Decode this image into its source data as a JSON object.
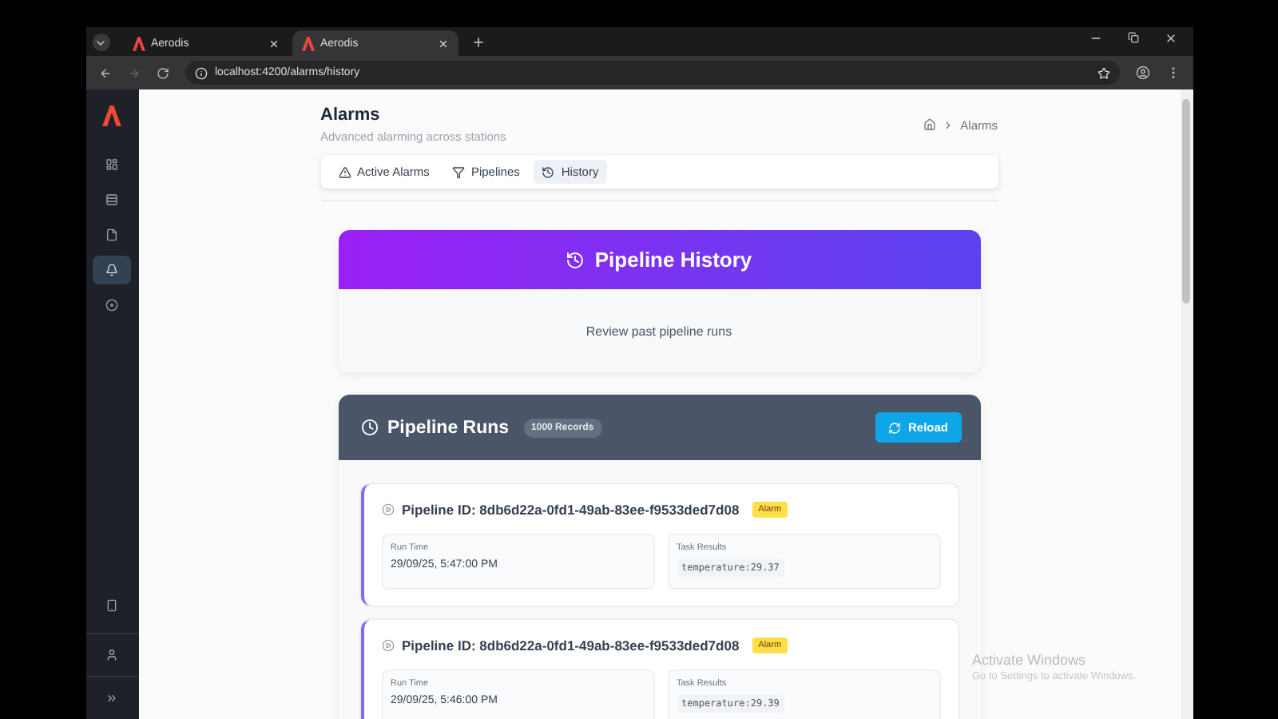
{
  "browser": {
    "tabs": [
      {
        "title": "Aerodis",
        "selected": false
      },
      {
        "title": "Aerodis",
        "selected": true
      }
    ],
    "url": "localhost:4200/alarms/history"
  },
  "sidebar": {
    "items": [
      {
        "selected": false
      },
      {
        "selected": false
      },
      {
        "selected": false
      },
      {
        "selected": true
      },
      {
        "selected": false
      }
    ]
  },
  "header": {
    "title": "Alarms",
    "subtitle": "Advanced alarming across stations",
    "breadcrumb": "Alarms"
  },
  "tabs": [
    {
      "label": "Active Alarms",
      "selected": false
    },
    {
      "label": "Pipelines",
      "selected": false
    },
    {
      "label": "History",
      "selected": true
    }
  ],
  "hero": {
    "title": "Pipeline History",
    "description": "Review past pipeline runs"
  },
  "runs": {
    "title": "Pipeline Runs",
    "count": "1000 Records",
    "reload": "Reload",
    "items": [
      {
        "pipeline": "Pipeline ID: 8db6d22a-0fd1-49ab-83ee-f9533ded7d08",
        "tag": "Alarm",
        "run_time_label": "Run Time",
        "run_time": "29/09/25, 5:47:00 PM",
        "results_label": "Task Results",
        "result": "temperature:29.37"
      },
      {
        "pipeline": "Pipeline ID: 8db6d22a-0fd1-49ab-83ee-f9533ded7d08",
        "tag": "Alarm",
        "run_time_label": "Run Time",
        "run_time": "29/09/25, 5:46:00 PM",
        "results_label": "Task Results",
        "result": "temperature:29.39"
      }
    ]
  },
  "os_notice": {
    "title": "Activate Windows",
    "text": "Go to Settings to activate Windows."
  }
}
